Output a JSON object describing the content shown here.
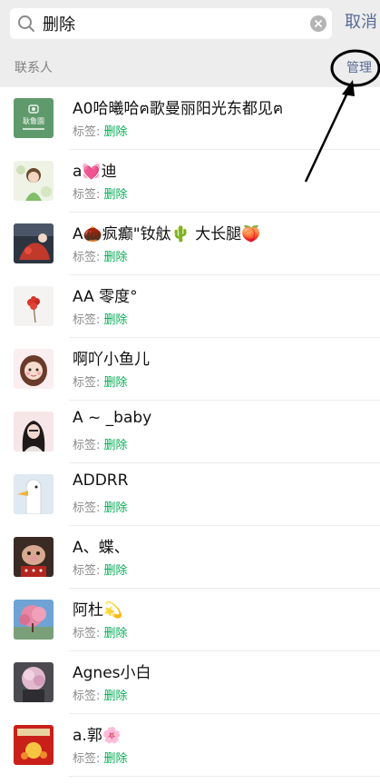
{
  "search": {
    "query": "删除",
    "cancel_label": "取消"
  },
  "section": {
    "title": "联系人",
    "manage_label": "管理"
  },
  "tag_prefix": "标签: ",
  "contacts": [
    {
      "name": "A0哈曦哈ฅ歌曼丽阳光东都见ฅ",
      "tag": "删除",
      "avatar_text": "耿鲁園"
    },
    {
      "name": "a💓迪",
      "tag": "删除"
    },
    {
      "name": "A🌰疯癫\"钕舦🌵 大长腿🍑",
      "tag": "删除"
    },
    {
      "name": "AA 零度°",
      "tag": "删除"
    },
    {
      "name": "啊吖小鱼儿",
      "tag": "删除"
    },
    {
      "name": "A ~ _baby",
      "tag": "删除"
    },
    {
      "name": "ADDRR",
      "tag": "删除"
    },
    {
      "name": "A、蝶、",
      "tag": "删除"
    },
    {
      "name": "阿杜💫",
      "tag": "删除"
    },
    {
      "name": "Agnes小白",
      "tag": "删除"
    },
    {
      "name": "a.郭🌸",
      "tag": "删除"
    }
  ],
  "colors": {
    "link": "#576b95",
    "tag_highlight": "#06ae56",
    "annotation": "#000000"
  }
}
